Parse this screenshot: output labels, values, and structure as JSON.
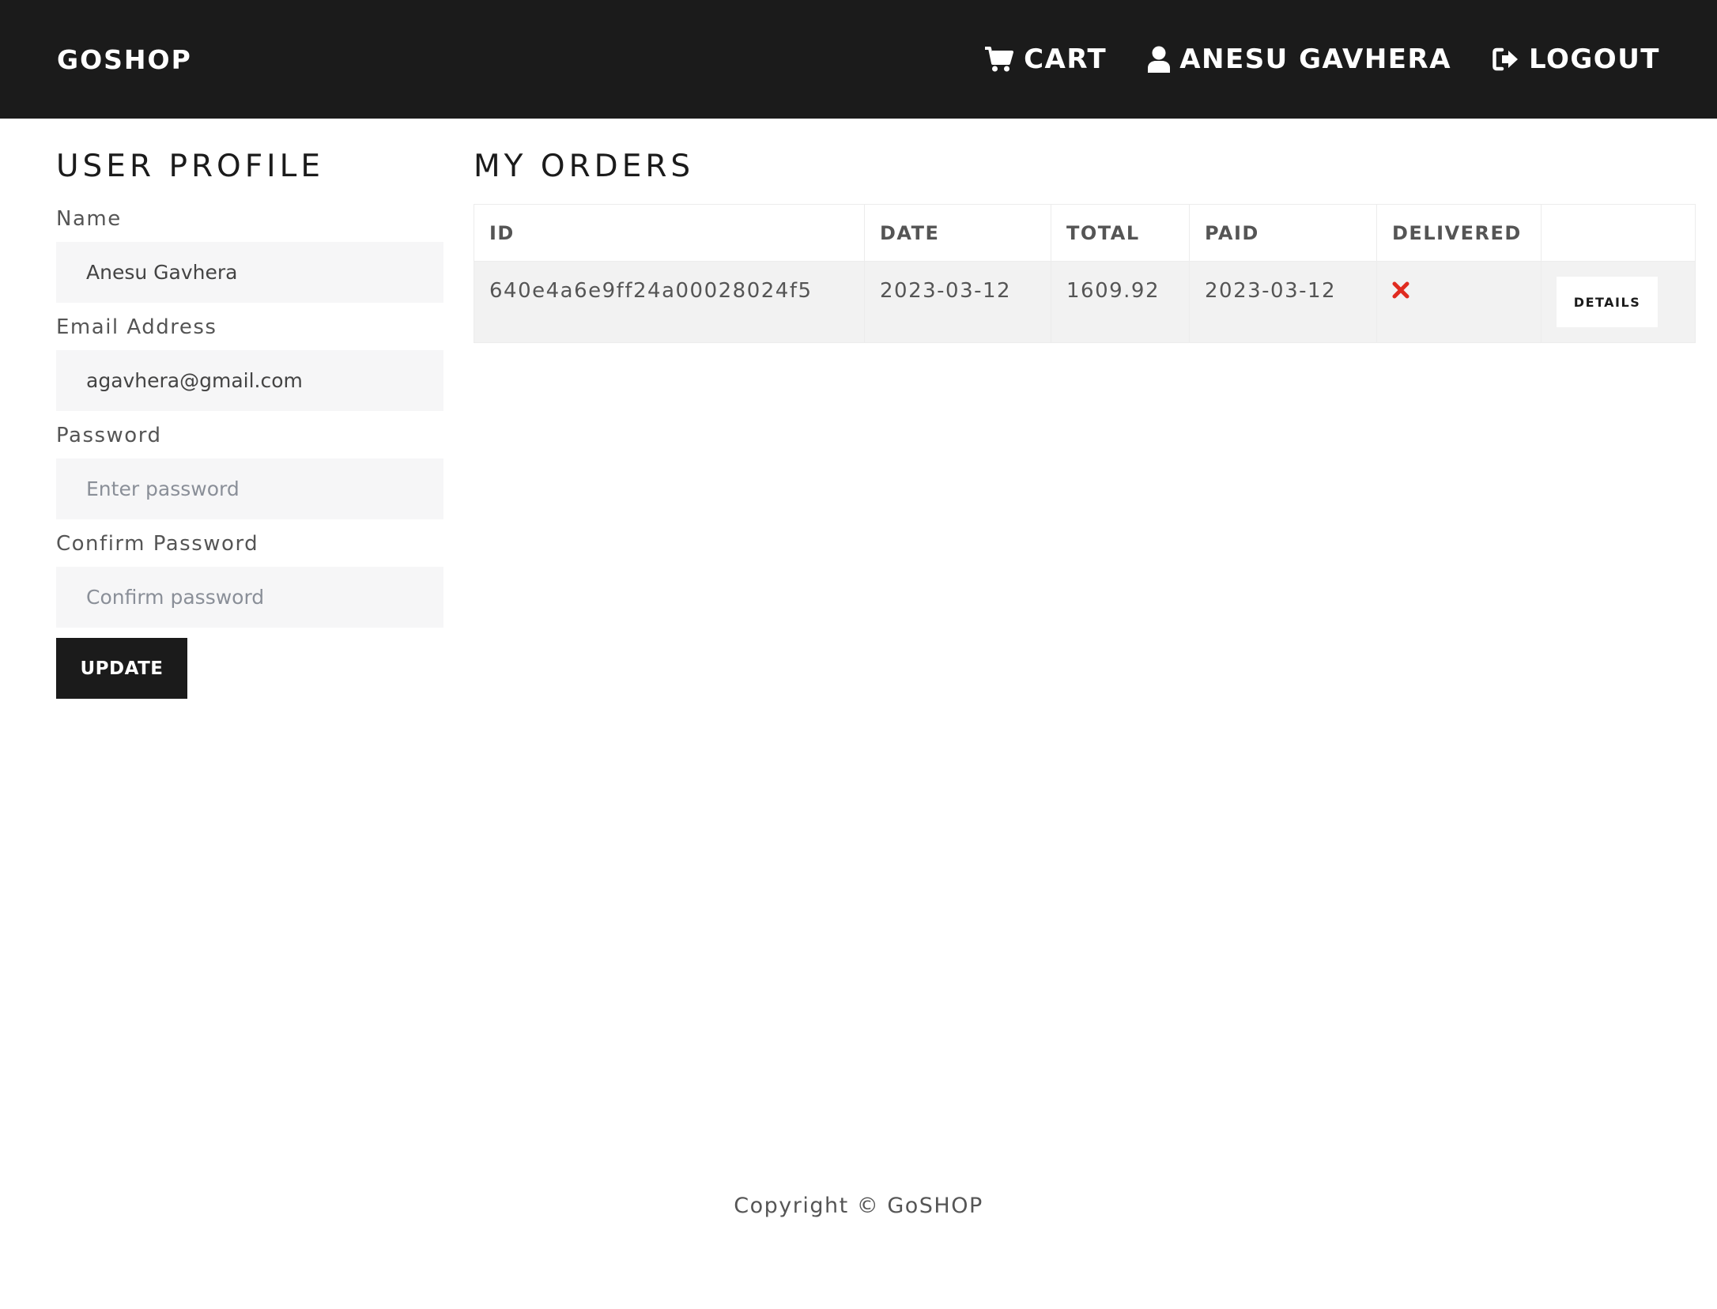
{
  "navbar": {
    "brand": "GOSHOP",
    "cart_label": "CART",
    "user_label": "ANESU GAVHERA",
    "logout_label": "LOGOUT"
  },
  "profile": {
    "title": "USER PROFILE",
    "name_label": "Name",
    "name_value": "Anesu Gavhera",
    "email_label": "Email Address",
    "email_value": "agavhera@gmail.com",
    "password_label": "Password",
    "password_placeholder": "Enter password",
    "confirm_label": "Confirm Password",
    "confirm_placeholder": "Confirm password",
    "update_label": "UPDATE"
  },
  "orders": {
    "title": "MY ORDERS",
    "columns": [
      "ID",
      "DATE",
      "TOTAL",
      "PAID",
      "DELIVERED",
      ""
    ],
    "rows": [
      {
        "id": "640e4a6e9ff24a00028024f5",
        "date": "2023-03-12",
        "total": "1609.92",
        "paid": "2023-03-12",
        "delivered": "times-icon",
        "details_label": "DETAILS"
      }
    ]
  },
  "footer": {
    "text": "Copyright © GoSHOP"
  },
  "colors": {
    "navbar_bg": "#1b1b1b",
    "accent_red": "#e02b20",
    "row_bg": "#f2f2f2",
    "input_bg": "#f6f6f7"
  }
}
